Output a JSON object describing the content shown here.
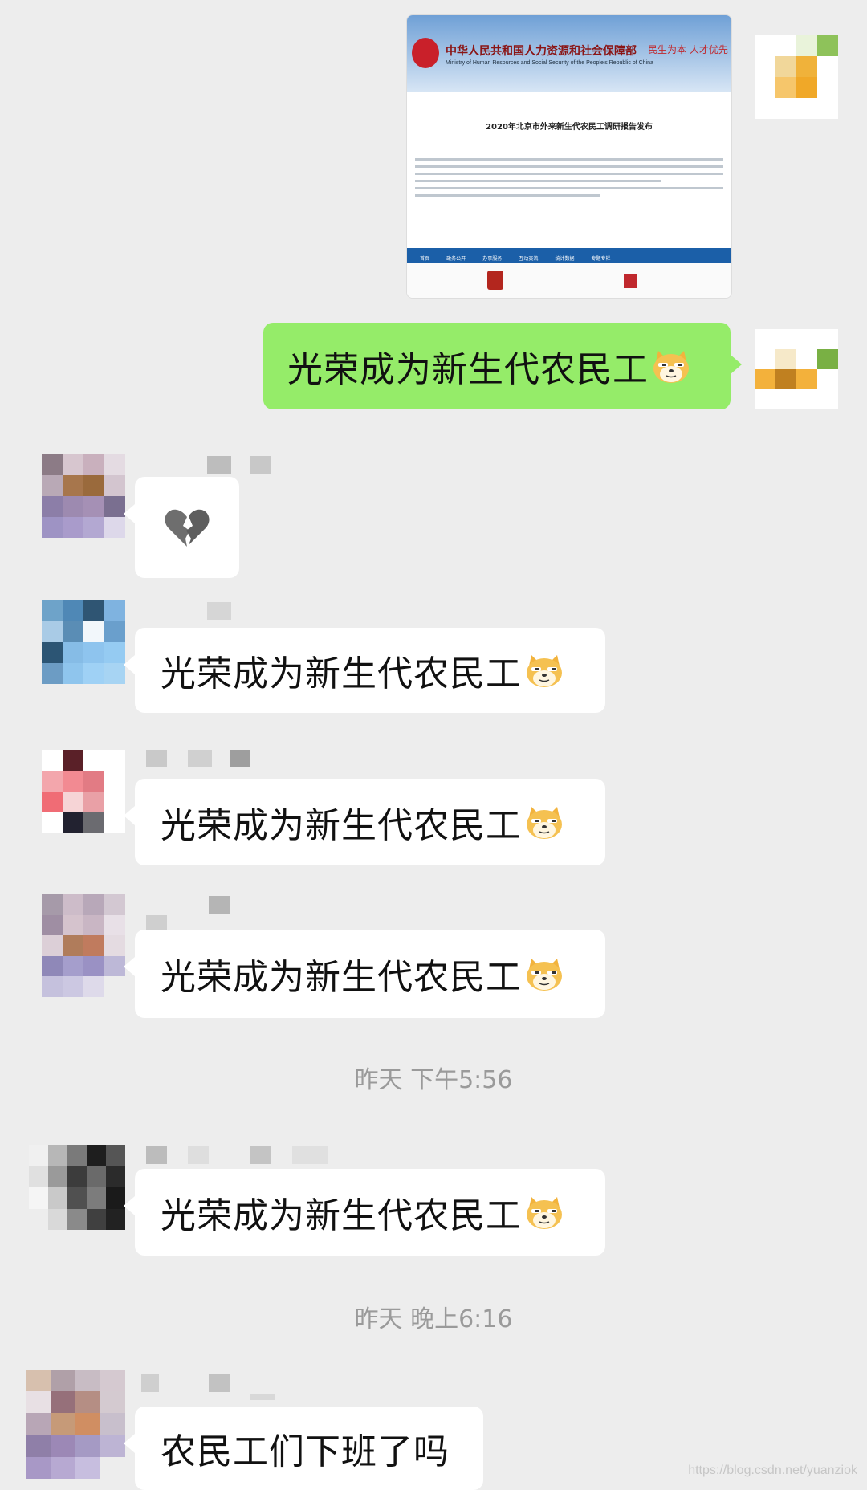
{
  "shared_card": {
    "ministry_name": "中华人民共和国人力资源和社会保障部",
    "ministry_en": "Ministry of Human Resources and Social Security of the People's Republic of China",
    "slogan": "民生为本 人才优先",
    "article_title": "2020年北京市外来新生代农民工调研报告发布",
    "nav_items": [
      "首页",
      "政务公开",
      "办事服务",
      "互动交流",
      "统计数据",
      "专题专栏"
    ]
  },
  "messages": [
    {
      "sender": "me",
      "text": "光荣成为新生代农民工",
      "emoji": "doge-icon"
    },
    {
      "sender": "other",
      "emoji": "broken-heart-icon"
    },
    {
      "sender": "other",
      "text": "光荣成为新生代农民工",
      "emoji": "doge-icon"
    },
    {
      "sender": "other",
      "text": "光荣成为新生代农民工",
      "emoji": "doge-icon"
    },
    {
      "sender": "other",
      "text": "光荣成为新生代农民工",
      "emoji": "doge-icon"
    },
    {
      "sender": "other",
      "text": "光荣成为新生代农民工",
      "emoji": "doge-icon"
    },
    {
      "sender": "other",
      "text": "农民工们下班了吗"
    }
  ],
  "timestamps": [
    "昨天 下午5:56",
    "昨天 晚上6:16"
  ],
  "watermark": "https://blog.csdn.net/yuanziok"
}
